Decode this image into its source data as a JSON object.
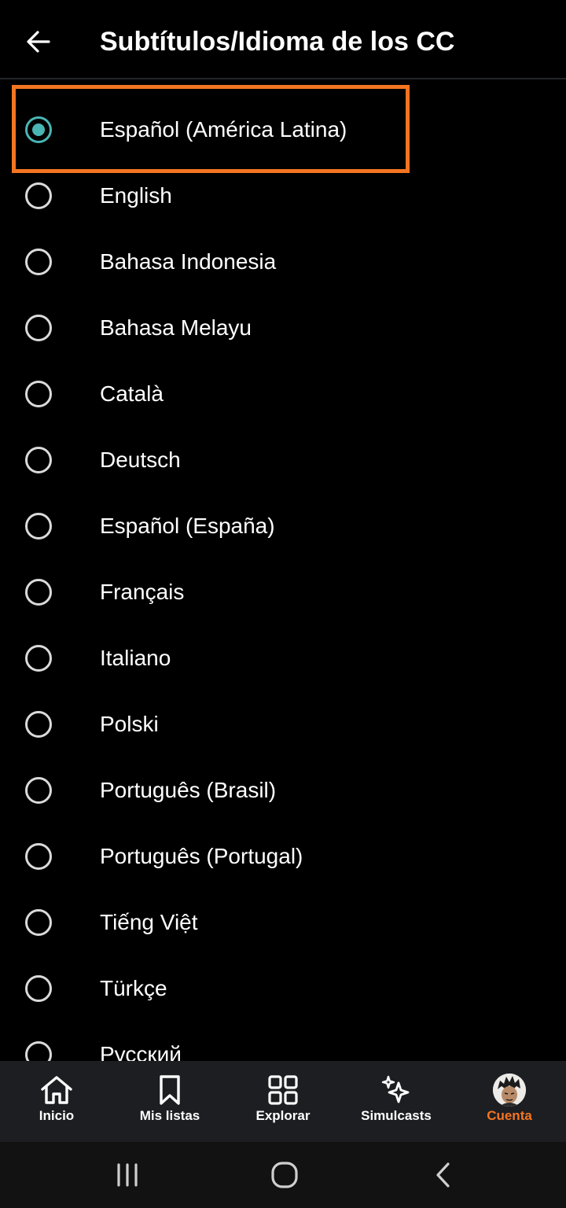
{
  "header": {
    "back_icon": "arrow-left-icon",
    "title": "Subtítulos/Idioma de los CC"
  },
  "languages": [
    {
      "label": "Español (América Latina)",
      "selected": true
    },
    {
      "label": "English",
      "selected": false
    },
    {
      "label": "Bahasa Indonesia",
      "selected": false
    },
    {
      "label": "Bahasa Melayu",
      "selected": false
    },
    {
      "label": "Català",
      "selected": false
    },
    {
      "label": "Deutsch",
      "selected": false
    },
    {
      "label": "Español (España)",
      "selected": false
    },
    {
      "label": "Français",
      "selected": false
    },
    {
      "label": "Italiano",
      "selected": false
    },
    {
      "label": "Polski",
      "selected": false
    },
    {
      "label": "Português (Brasil)",
      "selected": false
    },
    {
      "label": "Português (Portugal)",
      "selected": false
    },
    {
      "label": "Tiếng Việt",
      "selected": false
    },
    {
      "label": "Türkçe",
      "selected": false
    },
    {
      "label": "Русский",
      "selected": false
    }
  ],
  "bottom_nav": {
    "items": [
      {
        "label": "Inicio",
        "icon": "home-icon",
        "active": false
      },
      {
        "label": "Mis listas",
        "icon": "bookmark-icon",
        "active": false
      },
      {
        "label": "Explorar",
        "icon": "grid-icon",
        "active": false
      },
      {
        "label": "Simulcasts",
        "icon": "sparkle-icon",
        "active": false
      },
      {
        "label": "Cuenta",
        "icon": "avatar",
        "active": true
      }
    ]
  },
  "system_nav": [
    "recent-apps-icon",
    "home-circle-icon",
    "back-chevron-icon"
  ],
  "colors": {
    "background": "#000000",
    "accent_orange": "#f47521",
    "radio_selected": "#4ab5b5",
    "radio_unselected": "#dadada",
    "nav_background": "#1d1e22"
  }
}
